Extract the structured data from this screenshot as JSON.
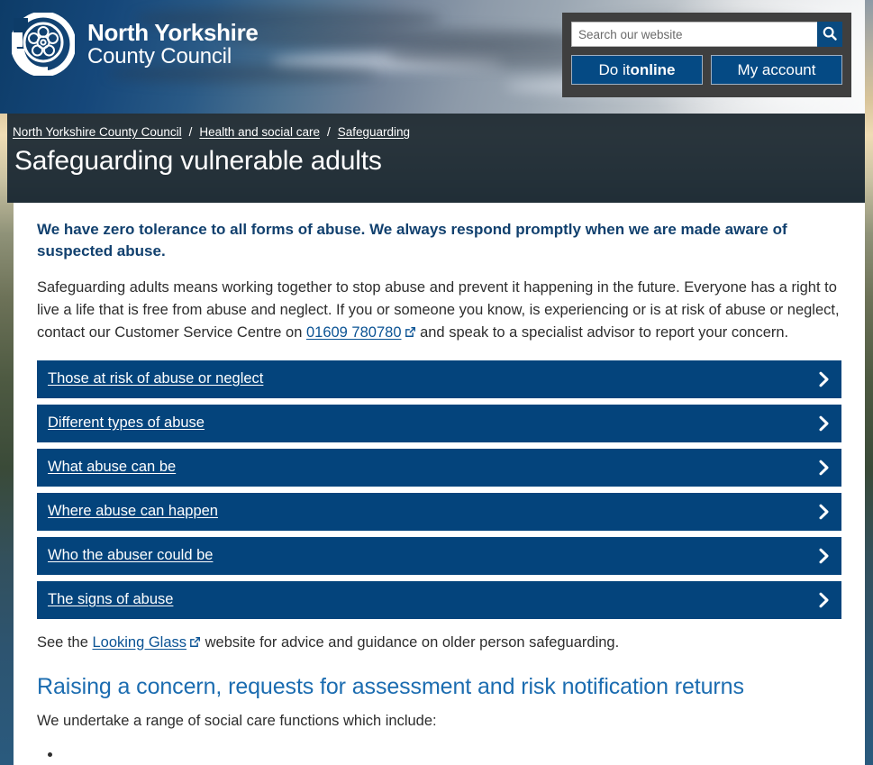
{
  "site": {
    "logo_line1": "North Yorkshire",
    "logo_line2": "County Council",
    "logo_icon": "nycc-rose-logo-icon"
  },
  "header": {
    "search": {
      "placeholder": "Search our website",
      "value": "",
      "button_icon": "search-icon"
    },
    "buttons": [
      {
        "prefix": "Do it ",
        "strong": "online",
        "name": "do-it-online-button"
      },
      {
        "label": "My account",
        "name": "my-account-button"
      }
    ],
    "panel_color": "#3f3f3f",
    "accent_color": "#054a84"
  },
  "breadcrumb": {
    "items": [
      "North Yorkshire County Council",
      "Health and social care",
      "Safeguarding"
    ],
    "separator": "/"
  },
  "page": {
    "title": "Safeguarding vulnerable adults"
  },
  "main": {
    "lead": "We have zero tolerance to all forms of abuse. We always respond promptly when we are made aware of suspected abuse.",
    "intro_part1": "Safeguarding adults means working together to stop abuse and prevent it happening in the future. Everyone has a right to live a life that is free from abuse and neglect. If you or someone you know, is experiencing or is at risk of abuse or neglect, contact our Customer Service Centre on ",
    "intro_link": "01609 780780",
    "intro_part2": " and speak to a specialist advisor to report your concern.",
    "accordion": [
      {
        "label": "Those at risk of abuse or neglect",
        "icon": "chevron-right-icon"
      },
      {
        "label": "Different types of abuse",
        "icon": "chevron-right-icon"
      },
      {
        "label": "What abuse can be",
        "icon": "chevron-right-icon"
      },
      {
        "label": "Where abuse can happen",
        "icon": "chevron-right-icon"
      },
      {
        "label": "Who the abuser could be",
        "icon": "chevron-right-icon"
      },
      {
        "label": "The signs of abuse",
        "icon": "chevron-right-icon"
      }
    ],
    "after_note_part1": "See the ",
    "after_note_link": "Looking Glass",
    "after_note_part2": " website for advice and guidance on older person safeguarding.",
    "section_heading": "Raising a concern, requests for assessment and risk notification returns",
    "section_intro": "We undertake a range of social care functions which include:",
    "accordion_color": "#04447c",
    "heading_color": "#1b6cb0",
    "link_color": "#0b5394"
  }
}
